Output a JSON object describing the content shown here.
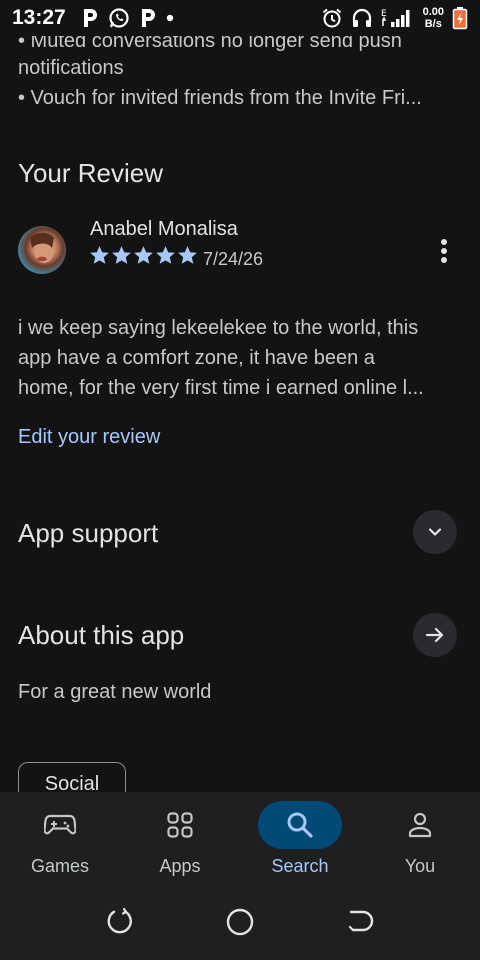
{
  "status_bar": {
    "time": "13:27",
    "net_speed_value": "0.00",
    "net_speed_unit": "B/s",
    "network_type": "E"
  },
  "whats_new": {
    "lines": [
      "• Muted conversations no longer send push",
      "notifications",
      "• Vouch for invited friends from the Invite Fri..."
    ]
  },
  "your_review": {
    "title": "Your Review",
    "reviewer_name": "Anabel Monalisa",
    "rating": 5,
    "rating_max": 5,
    "date": "7/24/26",
    "text_lines": [
      "i we keep saying lekeelekee to the world, this",
      "app have a comfort zone, it have been a",
      "home, for the very first time i earned online l..."
    ],
    "edit_label": "Edit your review"
  },
  "app_support": {
    "title": "App support"
  },
  "about": {
    "title": "About this app",
    "description": "For a great new world"
  },
  "chips": {
    "social": "Social"
  },
  "bottom_nav": {
    "items": [
      {
        "label": "Games",
        "icon": "gamepad-icon"
      },
      {
        "label": "Apps",
        "icon": "apps-grid-icon"
      },
      {
        "label": "Search",
        "icon": "search-icon",
        "active": true
      },
      {
        "label": "You",
        "icon": "person-icon"
      }
    ]
  },
  "colors": {
    "background": "#131314",
    "accent": "#a8c7fa",
    "active_pill": "#004a77",
    "star": "#a8c7fa"
  }
}
